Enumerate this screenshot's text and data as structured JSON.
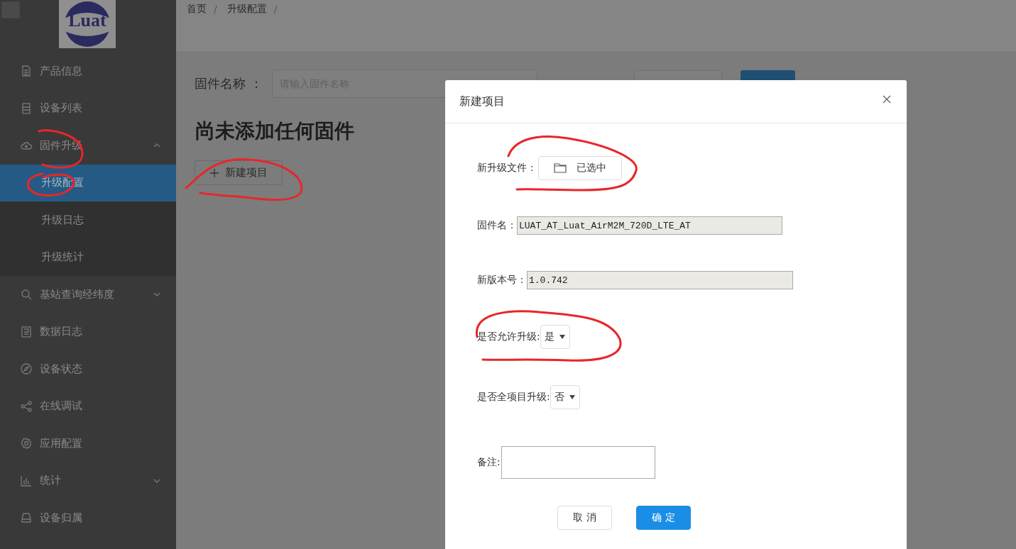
{
  "logo_text": "Luat",
  "sidebar": {
    "items": [
      {
        "label": "产品信息",
        "kind": "document",
        "selected": false
      },
      {
        "label": "设备列表",
        "kind": "list",
        "selected": false
      },
      {
        "label": "固件升级",
        "kind": "cloud",
        "selected": false,
        "expanded": true,
        "children": [
          {
            "label": "升级配置",
            "selected": true
          },
          {
            "label": "升级日志",
            "selected": false
          },
          {
            "label": "升级统计",
            "selected": false
          }
        ]
      },
      {
        "label": "基站查询经纬度",
        "kind": "search",
        "selected": false,
        "expanded": false
      },
      {
        "label": "数据日志",
        "kind": "log",
        "selected": false
      },
      {
        "label": "设备状态",
        "kind": "compass",
        "selected": false
      },
      {
        "label": "在线调试",
        "kind": "share",
        "selected": false
      },
      {
        "label": "应用配置",
        "kind": "gear",
        "selected": false
      },
      {
        "label": "统计",
        "kind": "chart",
        "selected": false,
        "expanded": false
      },
      {
        "label": "设备归属",
        "kind": "drive",
        "selected": false
      }
    ]
  },
  "breadcrumb": [
    {
      "label": "首页",
      "separator": "/"
    },
    {
      "label": "升级配置",
      "separator": "/"
    }
  ],
  "filter": {
    "label": "固件名称 ：",
    "placeholder": "请输入固件名称"
  },
  "empty_message": "尚未添加任何固件",
  "new_button": "新建项目",
  "modal": {
    "title": "新建项目",
    "fields": [
      {
        "kind": "file",
        "label": "新升级文件：",
        "value": "已选中"
      },
      {
        "kind": "readonly",
        "label": "固件名：",
        "value": "LUAT_AT_Luat_AirM2M_720D_LTE_AT"
      },
      {
        "kind": "readonly",
        "label": "新版本号：",
        "value": "1.0.742"
      },
      {
        "kind": "select",
        "label": "是否允许升级:",
        "value": "是"
      },
      {
        "kind": "select",
        "label": "是否全项目升级:",
        "value": "否"
      },
      {
        "kind": "textarea",
        "label": "备注:"
      }
    ],
    "buttons": [
      {
        "label": "取 消",
        "primary": false
      },
      {
        "label": "确 定",
        "primary": true
      }
    ]
  }
}
